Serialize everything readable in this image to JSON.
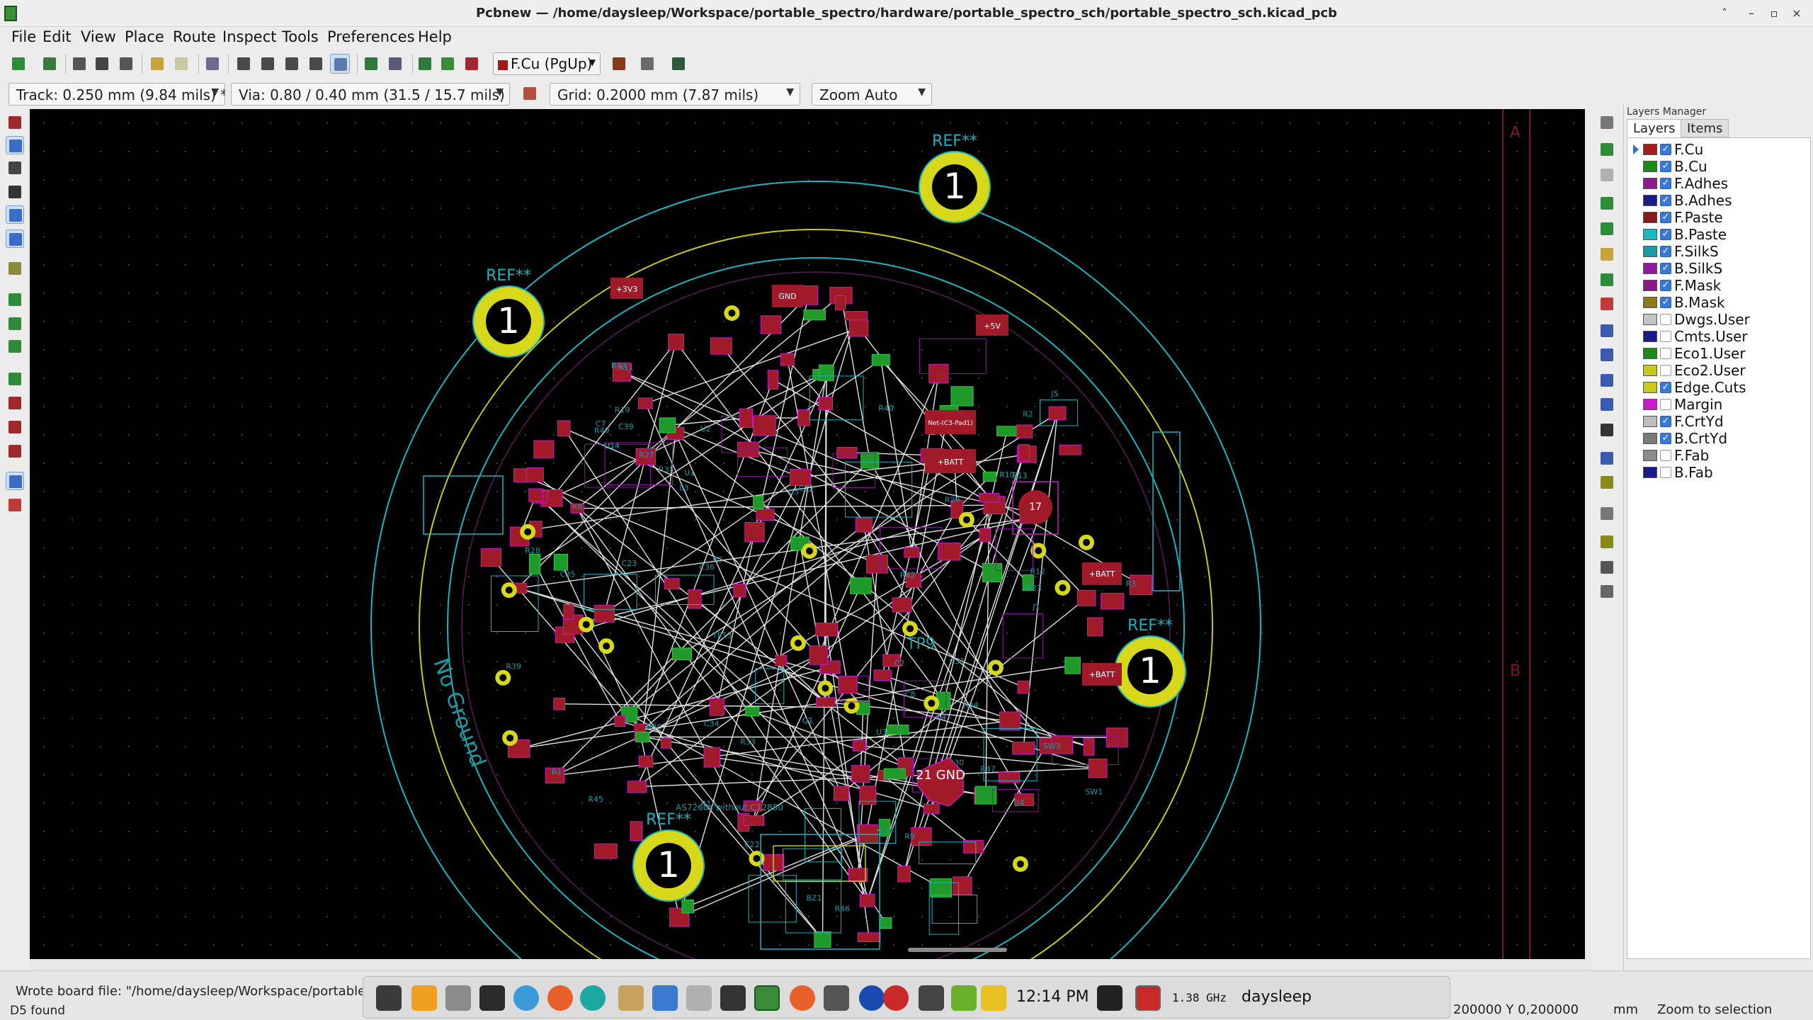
{
  "window": {
    "title": "Pcbnew — /home/daysleep/Workspace/portable_spectro/hardware/portable_spectro_sch/portable_spectro_sch.kicad_pcb",
    "controls": [
      "˄",
      "–",
      "▫",
      "×"
    ]
  },
  "menu": [
    "File",
    "Edit",
    "View",
    "Place",
    "Route",
    "Inspect",
    "Tools",
    "Preferences",
    "Help"
  ],
  "toolbar": {
    "active_layer": "F.Cu (PgUp)"
  },
  "options_bar": {
    "track": "Track: 0.250 mm (9.84 mils) *",
    "via": "Via: 0.80 / 0.40 mm (31.5 / 15.7 mils) *",
    "grid": "Grid: 0.2000 mm (7.87 mils)",
    "zoom": "Zoom Auto"
  },
  "board": {
    "ref_labels": [
      "REF**",
      "REF**",
      "REF**",
      "REF**"
    ],
    "mount_hole_number": "1",
    "silk_text": {
      "no_ground": "No Ground",
      "tp9": "TP9",
      "gnd_pad": "21\nGND",
      "note": "AS7260s without C12880",
      "plus3v3": "+3V3",
      "plus5v": "+5V",
      "batt": "+BATT",
      "gnd": "GND",
      "net_label": "Net-(C3-Pad1)",
      "pad17": "17",
      "side_a": "A",
      "side_b": "B"
    },
    "designators": [
      "BZ1",
      "R8",
      "R9",
      "U5",
      "C12",
      "R13",
      "R5",
      "C7",
      "C2",
      "C8",
      "R10",
      "R1",
      "R12",
      "R14",
      "C36",
      "C35",
      "C34",
      "C37",
      "R11",
      "R2",
      "R3",
      "Q1",
      "R28",
      "R29",
      "R30",
      "R19",
      "R23",
      "R27",
      "R33",
      "R34",
      "R35",
      "R38",
      "R39",
      "R40",
      "R42",
      "R43",
      "R45",
      "R46",
      "R47",
      "R49",
      "C39",
      "C22",
      "C23",
      "C31",
      "U1",
      "U2",
      "U3",
      "U4",
      "U14",
      "SW1",
      "SW3",
      "Q4",
      "J1",
      "J5",
      "L3",
      "TP13"
    ]
  },
  "layers_manager": {
    "title": "Layers Manager",
    "tabs": [
      "Layers",
      "Items"
    ],
    "active_tab": "Layers",
    "layers": [
      {
        "name": "F.Cu",
        "color": "#a61c1c",
        "visible": true,
        "active": true
      },
      {
        "name": "B.Cu",
        "color": "#1c8a1c",
        "visible": true
      },
      {
        "name": "F.Adhes",
        "color": "#8e1a8e",
        "visible": true
      },
      {
        "name": "B.Adhes",
        "color": "#1a1a8a",
        "visible": true
      },
      {
        "name": "F.Paste",
        "color": "#8a1a1a",
        "visible": true
      },
      {
        "name": "B.Paste",
        "color": "#1ab8c0",
        "visible": true
      },
      {
        "name": "F.SilkS",
        "color": "#1a9aa4",
        "visible": true
      },
      {
        "name": "B.SilkS",
        "color": "#8e1a9e",
        "visible": true
      },
      {
        "name": "F.Mask",
        "color": "#8a1a8a",
        "visible": true
      },
      {
        "name": "B.Mask",
        "color": "#8a7a1a",
        "visible": true
      },
      {
        "name": "Dwgs.User",
        "color": "#c4c4c4",
        "visible": false
      },
      {
        "name": "Cmts.User",
        "color": "#1a1a8a",
        "visible": false
      },
      {
        "name": "Eco1.User",
        "color": "#1a8a1a",
        "visible": false
      },
      {
        "name": "Eco2.User",
        "color": "#c8c81a",
        "visible": false
      },
      {
        "name": "Edge.Cuts",
        "color": "#c8c81a",
        "visible": true
      },
      {
        "name": "Margin",
        "color": "#c81ac8",
        "visible": false
      },
      {
        "name": "F.CrtYd",
        "color": "#bdbdbd",
        "visible": true
      },
      {
        "name": "B.CrtYd",
        "color": "#7a7a7a",
        "visible": true
      },
      {
        "name": "F.Fab",
        "color": "#8a8a8a",
        "visible": false
      },
      {
        "name": "B.Fab",
        "color": "#1a1a8a",
        "visible": false
      }
    ]
  },
  "status": {
    "message": "Wrote board file: \"/home/daysleep/Workspace/portable_spect",
    "found": "D5 found",
    "coords": "200000  Y 0,200000",
    "units": "mm",
    "zoom_mode": "Zoom to selection"
  },
  "taskbar": {
    "clock": "12:14 PM",
    "cpu": "1.38 GHz",
    "user": "daysleep"
  }
}
